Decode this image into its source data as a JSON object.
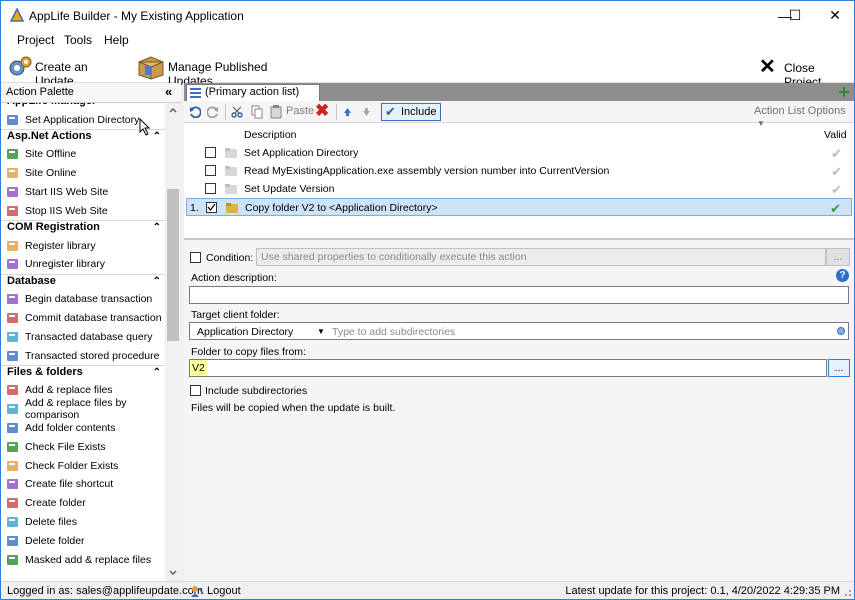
{
  "window": {
    "title": "AppLife Builder - My Existing Application",
    "minimize": "—",
    "maximize": "☐",
    "close": "✕"
  },
  "menu": [
    "Project",
    "Tools",
    "Help"
  ],
  "toolbar": {
    "create_update": "Create an Update...",
    "manage_updates": "Manage Published Updates...",
    "close_project": "Close Project",
    "close_glyph": "✕"
  },
  "palette": {
    "title": "Action Palette",
    "collapse_glyph": "«",
    "groups": [
      {
        "name": "AppLife Manager",
        "items": [
          "Set Application Directory"
        ]
      },
      {
        "name": "Asp.Net Actions",
        "items": [
          "Site Offline",
          "Site Online",
          "Start IIS Web Site",
          "Stop IIS Web Site"
        ]
      },
      {
        "name": "COM Registration",
        "items": [
          "Register library",
          "Unregister library"
        ]
      },
      {
        "name": "Database",
        "items": [
          "Begin database transaction",
          "Commit database transaction",
          "Transacted database query",
          "Transacted stored procedure"
        ]
      },
      {
        "name": "Files & folders",
        "items": [
          "Add & replace files",
          "Add & replace files by comparison",
          "Add folder contents",
          "Check File Exists",
          "Check Folder Exists",
          "Create file shortcut",
          "Create folder",
          "Delete files",
          "Delete folder",
          "Masked add & replace files"
        ]
      }
    ]
  },
  "main": {
    "tab_label": "(Primary action list)",
    "actbar": {
      "paste": "Paste",
      "include": "Include",
      "options": "Action List Options"
    },
    "grid_headers": {
      "description": "Description",
      "valid": "Valid"
    },
    "rows": [
      {
        "num": "",
        "checked": false,
        "desc": "Set Application Directory"
      },
      {
        "num": "",
        "checked": false,
        "desc": "Read MyExistingApplication.exe assembly version number into CurrentVersion"
      },
      {
        "num": "",
        "checked": false,
        "desc": "Set Update Version"
      },
      {
        "num": "1.",
        "checked": true,
        "desc": "Copy folder V2 to <Application Directory>"
      }
    ],
    "details": {
      "condition_label": "Condition:",
      "condition_placeholder": "Use shared properties to conditionally execute this action",
      "condition_btn": "...",
      "desc_label": "Action description:",
      "target_label": "Target client folder:",
      "target_value": "Application Directory",
      "target_placeholder": "Type to add subdirectories",
      "copy_from_label": "Folder to copy files from:",
      "copy_from_value": "V2",
      "browse_btn": "...",
      "include_sub_label": "Include subdirectories",
      "note": "Files will be copied when the update is built."
    }
  },
  "status": {
    "logged_in": "Logged in as: sales@applifeupdate.com",
    "logout": "Logout",
    "latest": "Latest update for this project: 0.1, 4/20/2022 4:29:35 PM"
  },
  "colors": {
    "accent": "#2b7fd8",
    "selected_row": "#cde3f7",
    "highlight_field": "#ffff99",
    "valid_check": "#3a9a3a"
  }
}
